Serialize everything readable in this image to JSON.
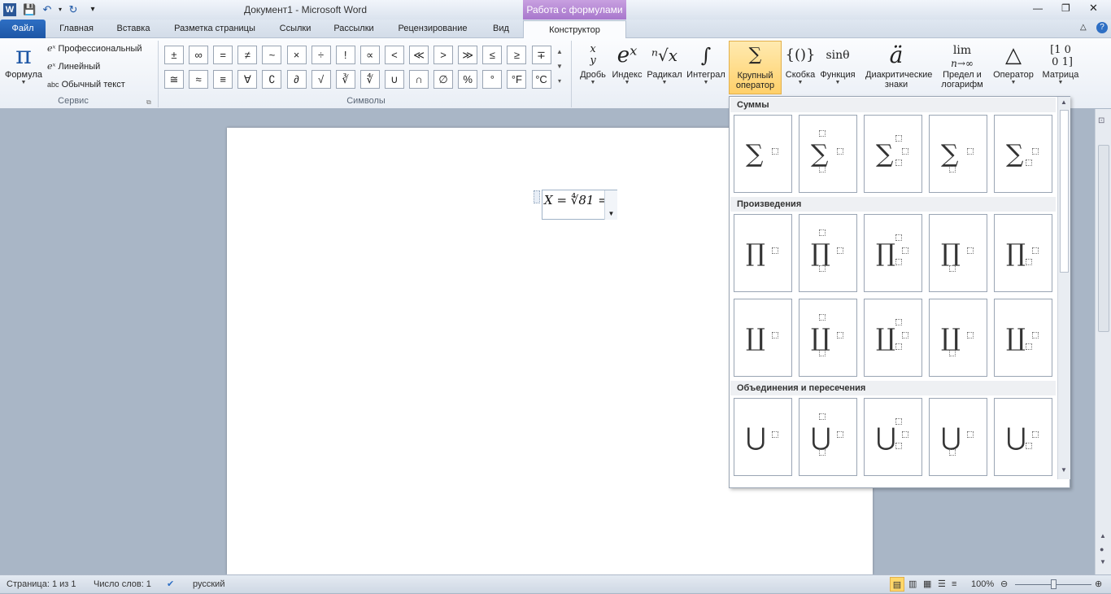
{
  "title": "Документ1  -  Microsoft Word",
  "context_tab_header": "Работа с формулами",
  "tabs": [
    "Файл",
    "Главная",
    "Вставка",
    "Разметка страницы",
    "Ссылки",
    "Рассылки",
    "Рецензирование",
    "Вид",
    "Конструктор"
  ],
  "tools": {
    "formula_label": "Формула",
    "professional": "Профессиональный",
    "linear": "Линейный",
    "plain_text": "Обычный текст",
    "group_service": "Сервис"
  },
  "symbols": {
    "row1": [
      "±",
      "∞",
      "=",
      "≠",
      "~",
      "×",
      "÷",
      "!",
      "∝",
      "<",
      "≪",
      ">",
      "≫",
      "≤",
      "≥",
      "∓"
    ],
    "row2": [
      "≅",
      "≈",
      "≡",
      "∀",
      "∁",
      "∂",
      "√",
      "∛",
      "∜",
      "∪",
      "∩",
      "∅",
      "%",
      "°",
      "°F",
      "°C"
    ],
    "group_label": "Символы"
  },
  "structures": [
    {
      "glyph": "x/y",
      "label": "Дробь"
    },
    {
      "glyph": "eˣ",
      "label": "Индекс"
    },
    {
      "glyph": "ⁿ√x",
      "label": "Радикал"
    },
    {
      "glyph": "∫",
      "label": "Интеграл"
    },
    {
      "glyph": "∑",
      "label": "Крупный оператор"
    },
    {
      "glyph": "{()}",
      "label": "Скобка"
    },
    {
      "glyph": "sinθ",
      "label": "Функция"
    },
    {
      "glyph": "ä",
      "label": "Диакритические знаки"
    },
    {
      "glyph": "lim",
      "label": "Предел и логарифм"
    },
    {
      "glyph": "△",
      "label": "Оператор"
    },
    {
      "glyph": "[10;01]",
      "label": "Матрица"
    }
  ],
  "equation": {
    "text": "X = ∜81 ="
  },
  "gallery": {
    "sections": [
      {
        "title": "Суммы",
        "symbol": "∑",
        "rows": 1
      },
      {
        "title": "Произведения",
        "symbol": "∏",
        "rows": 1
      },
      {
        "title": "",
        "symbol": "∐",
        "rows": 1
      },
      {
        "title": "Объединения и пересечения",
        "symbol": "⋃",
        "rows": 1
      }
    ]
  },
  "status": {
    "page": "Страница: 1 из 1",
    "words": "Число слов: 1",
    "language": "русский",
    "zoom": "100%"
  },
  "colors": {
    "file_tab": "#1d56a5",
    "context": "#a877cc",
    "highlight": "#ffd86a"
  }
}
